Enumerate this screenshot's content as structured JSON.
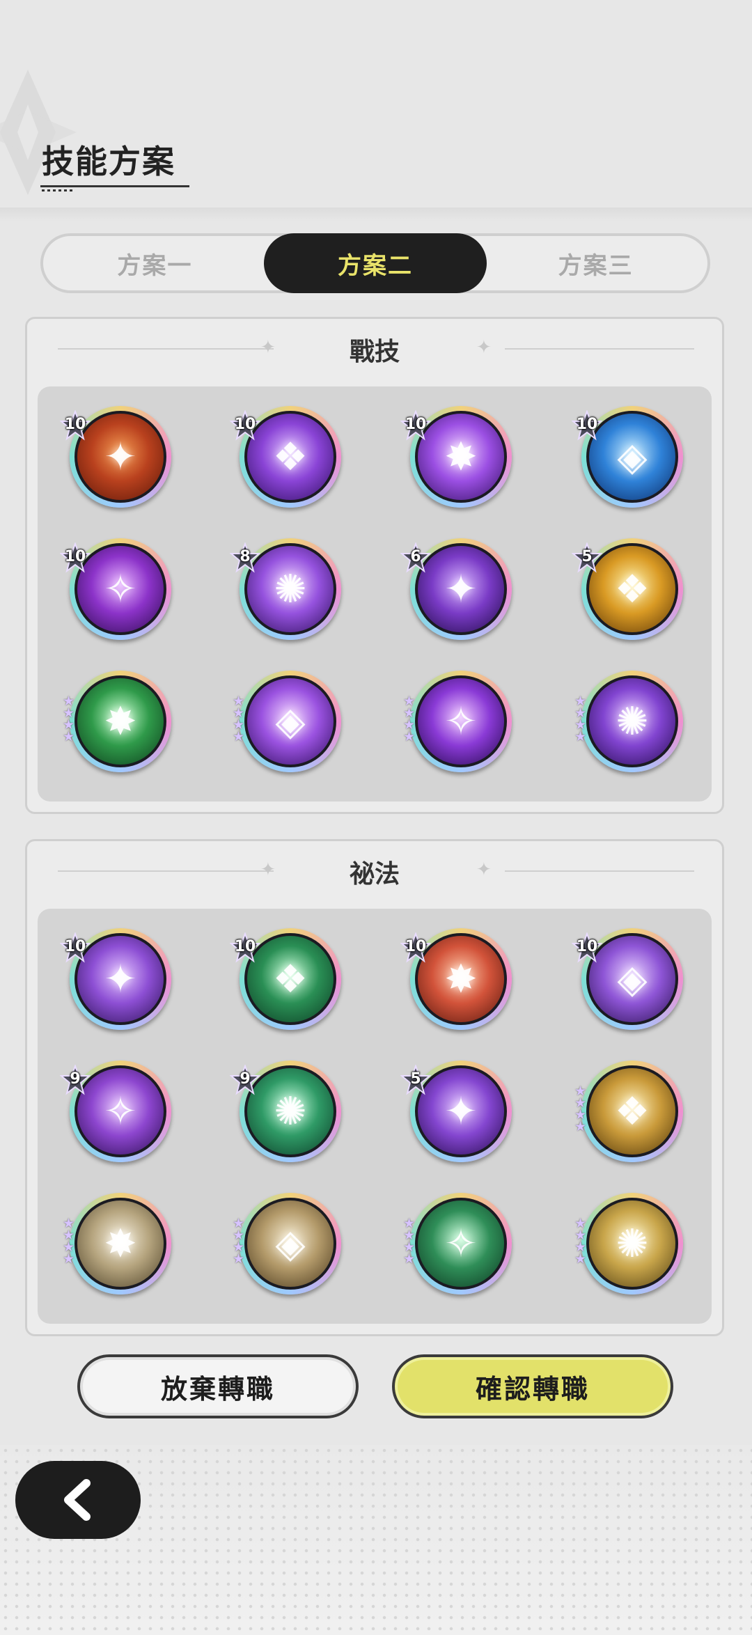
{
  "title": "技能方案",
  "tabs": [
    {
      "label": "方案一",
      "active": false
    },
    {
      "label": "方案二",
      "active": true
    },
    {
      "label": "方案三",
      "active": false
    }
  ],
  "sections": {
    "combat": {
      "title": "戰技",
      "skills": [
        {
          "level": "10",
          "stars": 0,
          "icon": "orange-fortress-icon",
          "colors": [
            "#f49a52",
            "#b9411e",
            "#5a1608"
          ]
        },
        {
          "level": "10",
          "stars": 0,
          "icon": "purple-golem-icon",
          "colors": [
            "#e1c2ff",
            "#8a44d6",
            "#2e0e5e"
          ]
        },
        {
          "level": "10",
          "stars": 0,
          "icon": "purple-burst-icon",
          "colors": [
            "#f0d2ff",
            "#9b4fe3",
            "#321060"
          ]
        },
        {
          "level": "10",
          "stars": 0,
          "icon": "blue-beast-icon",
          "colors": [
            "#bfe8ff",
            "#2f82d8",
            "#0a2a66"
          ]
        },
        {
          "level": "10",
          "stars": 0,
          "icon": "purple-hand-icon",
          "colors": [
            "#e8b6ff",
            "#8c33c9",
            "#2b0b4d"
          ]
        },
        {
          "level": "8",
          "stars": 0,
          "icon": "purple-shield-icon",
          "colors": [
            "#efd6ff",
            "#9552de",
            "#2c0e58"
          ]
        },
        {
          "level": "6",
          "stars": 0,
          "icon": "purple-star-icon",
          "colors": [
            "#d8b6ff",
            "#7a3bc6",
            "#1e0a44"
          ]
        },
        {
          "level": "5",
          "stars": 0,
          "icon": "golden-sparkle-icon",
          "colors": [
            "#fff1a8",
            "#d99a24",
            "#5a3406"
          ]
        },
        {
          "level": "",
          "stars": 4,
          "icon": "green-comet-icon",
          "colors": [
            "#c8ffd0",
            "#2f9a4a",
            "#0c3a1a"
          ]
        },
        {
          "level": "",
          "stars": 4,
          "icon": "purple-vortex-icon",
          "colors": [
            "#f2d4ff",
            "#9a52e0",
            "#2d0c5a"
          ]
        },
        {
          "level": "",
          "stars": 4,
          "icon": "purple-eye-icon",
          "colors": [
            "#efc8ff",
            "#8a3ad6",
            "#22084a"
          ]
        },
        {
          "level": "",
          "stars": 4,
          "icon": "purple-crest-icon",
          "colors": [
            "#e4c6ff",
            "#8144d0",
            "#250b50"
          ]
        }
      ]
    },
    "secret": {
      "title": "祕法",
      "skills": [
        {
          "level": "10",
          "stars": 0,
          "icon": "purple-aura-icon",
          "colors": [
            "#e3c4ff",
            "#8d4fd4",
            "#2b1154"
          ]
        },
        {
          "level": "10",
          "stars": 0,
          "icon": "green-spark-icon",
          "colors": [
            "#c9ffd9",
            "#2a8f55",
            "#0b3a22"
          ]
        },
        {
          "level": "10",
          "stars": 0,
          "icon": "red-fist-icon",
          "colors": [
            "#ffc9a8",
            "#d2533a",
            "#55160c"
          ]
        },
        {
          "level": "10",
          "stars": 0,
          "icon": "purple-arrows-icon",
          "colors": [
            "#e7d0ff",
            "#8e55d6",
            "#2a1150"
          ]
        },
        {
          "level": "9",
          "stars": 0,
          "icon": "purple-heart-icon",
          "colors": [
            "#eac9ff",
            "#8d46cf",
            "#2a0d4f"
          ]
        },
        {
          "level": "9",
          "stars": 0,
          "icon": "green-figure-icon",
          "colors": [
            "#c8ffe0",
            "#2f9a66",
            "#0b3a26"
          ]
        },
        {
          "level": "5",
          "stars": 0,
          "icon": "purple-arm-icon",
          "colors": [
            "#e2c4ff",
            "#8446d0",
            "#240a4a"
          ]
        },
        {
          "level": "",
          "stars": 4,
          "icon": "golden-praying-icon",
          "colors": [
            "#fff0b8",
            "#c99a3a",
            "#4e3408"
          ]
        },
        {
          "level": "",
          "stars": 4,
          "icon": "beige-figure-icon",
          "colors": [
            "#f6efdd",
            "#b5a47e",
            "#4b3f26"
          ]
        },
        {
          "level": "",
          "stars": 4,
          "icon": "beige-upward-icon",
          "colors": [
            "#f6ecd2",
            "#b39a6a",
            "#47361b"
          ]
        },
        {
          "level": "",
          "stars": 4,
          "icon": "green-wings-icon",
          "colors": [
            "#cfffdf",
            "#2f8e58",
            "#0c3620"
          ]
        },
        {
          "level": "",
          "stars": 4,
          "icon": "golden-wave-icon",
          "colors": [
            "#fff4c4",
            "#c8a54a",
            "#4f3d12"
          ]
        }
      ]
    }
  },
  "buttons": {
    "cancel": "放棄轉職",
    "confirm": "確認轉職"
  },
  "back_icon": "chevron-left-icon"
}
